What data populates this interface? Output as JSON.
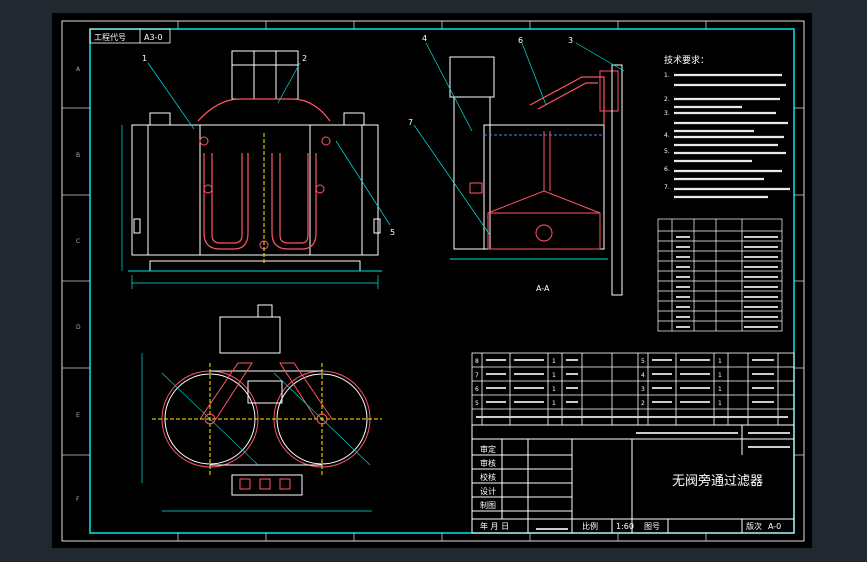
{
  "drawing": {
    "code_box": {
      "label": "工程代号",
      "value": "A3-0"
    },
    "section_label": "A-A",
    "callouts": [
      "1",
      "2",
      "3",
      "4",
      "5",
      "6",
      "7"
    ],
    "tech_title": "技术要求：",
    "tech_notes": [
      "1.",
      "2.",
      "3.",
      "4.",
      "5.",
      "6.",
      "7."
    ],
    "bom_rows": [
      [
        "8",
        "",
        "",
        "1",
        "",
        "",
        "5",
        "",
        "",
        "1",
        "",
        ""
      ],
      [
        "7",
        "",
        "",
        "1",
        "",
        "",
        "4",
        "",
        "",
        "1",
        "",
        ""
      ],
      [
        "6",
        "",
        "",
        "1",
        "",
        "",
        "3",
        "",
        "",
        "1",
        "",
        ""
      ],
      [
        "5",
        "",
        "",
        "1",
        "",
        "",
        "2",
        "",
        "",
        "1",
        "",
        ""
      ]
    ],
    "title_block": {
      "roles": [
        "审定",
        "审核",
        "校核",
        "设计",
        "制图"
      ],
      "title": "无阀旁通过滤器",
      "scale_label": "比例",
      "scale": "1:60",
      "drawing_no_label": "图号",
      "date_label": "年 月 日",
      "sheet_label": "版次",
      "sheet_value": "A-0"
    },
    "zone_letters": [
      "A",
      "B",
      "C",
      "D",
      "E",
      "F"
    ],
    "zone_numbers": [
      "1",
      "2",
      "3",
      "4",
      "5",
      "6",
      "7",
      "8"
    ]
  }
}
